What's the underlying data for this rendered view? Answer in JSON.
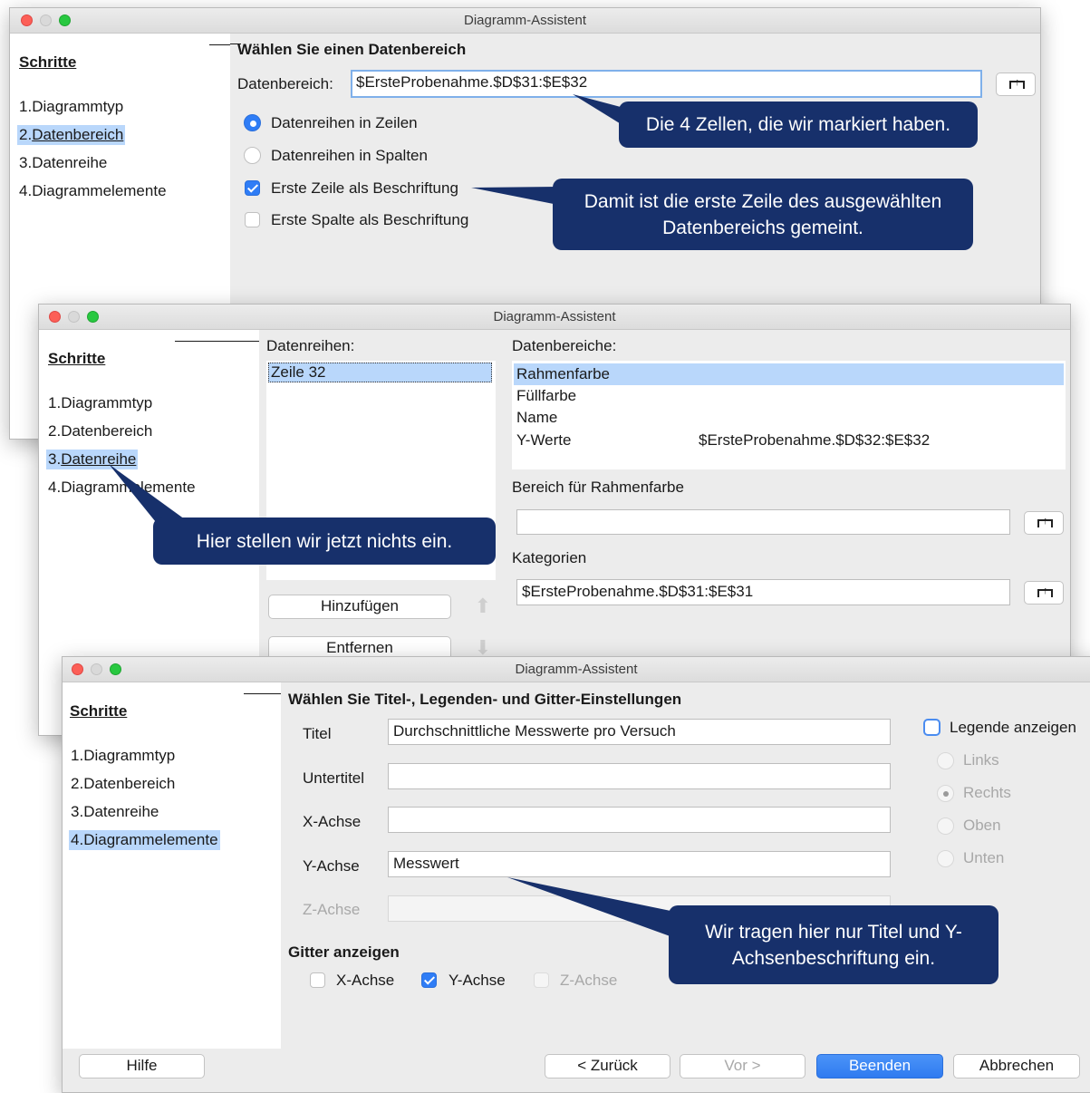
{
  "window1": {
    "title": "Diagramm-Assistent",
    "sidebar": {
      "heading": "Schritte",
      "steps": [
        "1.",
        "Diagrammtyp",
        "2.",
        "Datenbereich",
        "3.",
        "Datenreihe",
        "4.",
        "Diagrammelemente"
      ]
    },
    "section_title": "Wählen Sie einen Datenbereich",
    "range_label": "Datenbereich:",
    "range_value": "$ErsteProbenahme.$D$31:$E$32",
    "opt_rows": "Datenreihen in Zeilen",
    "opt_cols": "Datenreihen in Spalten",
    "chk_first_row": "Erste Zeile als Beschriftung",
    "chk_first_col": "Erste Spalte als Beschriftung"
  },
  "window2": {
    "title": "Diagramm-Assistent",
    "sidebar": {
      "heading": "Schritte",
      "steps": [
        "1.",
        "Diagrammtyp",
        "2.",
        "Datenbereich",
        "3.",
        "Datenreihe",
        "4.",
        "Diagrammelemente"
      ]
    },
    "series_label": "Datenreihen:",
    "series": [
      "Zeile 32"
    ],
    "ranges_label": "Datenbereiche:",
    "ranges": [
      {
        "name": "Rahmenfarbe",
        "value": ""
      },
      {
        "name": "Füllfarbe",
        "value": ""
      },
      {
        "name": "Name",
        "value": ""
      },
      {
        "name": "Y-Werte",
        "value": "$ErsteProbenahme.$D$32:$E$32"
      }
    ],
    "range_for_label": "Bereich für Rahmenfarbe",
    "range_for_value": "",
    "categories_label": "Kategorien",
    "categories_value": "$ErsteProbenahme.$D$31:$E$31",
    "add_button": "Hinzufügen",
    "remove_button": "Entfernen"
  },
  "window3": {
    "title": "Diagramm-Assistent",
    "sidebar": {
      "heading": "Schritte",
      "steps": [
        "1.",
        "Diagrammtyp",
        "2.",
        "Datenbereich",
        "3.",
        "Datenreihe",
        "4.",
        "Diagrammelemente"
      ]
    },
    "section_title": "Wählen Sie Titel-, Legenden- und Gitter-Einstellungen",
    "fields": {
      "title_label": "Titel",
      "title_value": "Durchschnittliche Messwerte pro Versuch",
      "subtitle_label": "Untertitel",
      "subtitle_value": "",
      "x_label": "X-Achse",
      "x_value": "",
      "y_label": "Y-Achse",
      "y_value": "Messwert",
      "z_label": "Z-Achse",
      "z_value": ""
    },
    "legend": {
      "show_label": "Legende anzeigen",
      "options": [
        "Links",
        "Rechts",
        "Oben",
        "Unten"
      ]
    },
    "grid": {
      "heading": "Gitter anzeigen",
      "x": "X-Achse",
      "y": "Y-Achse",
      "z": "Z-Achse"
    },
    "buttons": {
      "help": "Hilfe",
      "back": "< Zurück",
      "next": "Vor >",
      "finish": "Beenden",
      "cancel": "Abbrechen"
    }
  },
  "callouts": {
    "c1": "Die 4 Zellen, die wir markiert haben.",
    "c2": "Damit ist die erste Zeile des ausgewählten Datenbereichs gemeint.",
    "c3": "Hier stellen wir jetzt nichts ein.",
    "c4": "Wir tragen hier nur Titel und Y-Achsenbeschriftung ein."
  },
  "colors": {
    "callout_bg": "#17306b",
    "accent": "#2f7df6",
    "selection": "#b9d7fb"
  }
}
